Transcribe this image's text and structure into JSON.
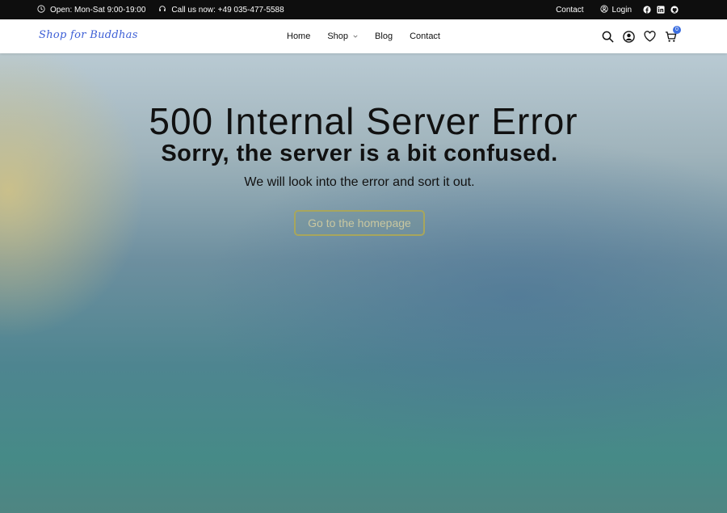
{
  "topbar": {
    "hours": "Open: Mon-Sat 9:00-19:00",
    "phone": "Call us now: +49 035-477-5588",
    "contact": "Contact",
    "login": "Login"
  },
  "header": {
    "logo": "Shop for Buddhas",
    "nav": [
      "Home",
      "Shop",
      "Blog",
      "Contact"
    ],
    "cart_count": "0",
    "accent_color": "#3d6fe0"
  },
  "hero": {
    "title": "500 Internal Server Error",
    "subtitle": "Sorry, the server is a bit confused.",
    "message": "We will look into the error and sort it out.",
    "button": "Go to the homepage"
  }
}
